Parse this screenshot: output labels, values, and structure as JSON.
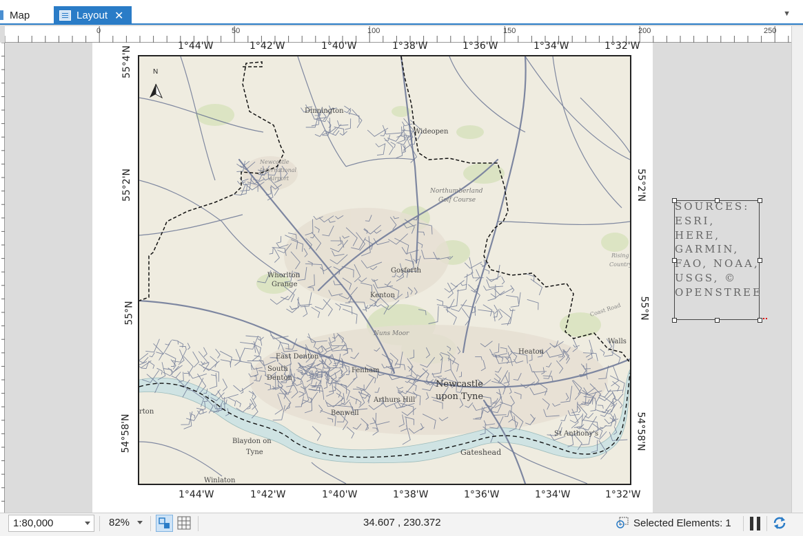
{
  "tabs": [
    {
      "label": "Map",
      "active": false
    },
    {
      "label": "Layout",
      "active": true,
      "close": "✕"
    }
  ],
  "ruler": {
    "horizontal_labels": [
      "0",
      "50",
      "100",
      "150",
      "200",
      "250"
    ]
  },
  "map": {
    "north_arrow": "N",
    "grid_top": [
      "1°44'W",
      "1°42'W",
      "1°40'W",
      "1°38'W",
      "1°36'W",
      "1°34'W",
      "1°32'W"
    ],
    "grid_bottom": [
      "1°44'W",
      "1°42'W",
      "1°40'W",
      "1°38'W",
      "1°36'W",
      "1°34'W",
      "1°32'W"
    ],
    "grid_left": [
      "55°4'N",
      "55°2'N",
      "55°N",
      "54°58'N"
    ],
    "grid_right": [
      "55°2'N",
      "55°N",
      "54°58'N"
    ],
    "place_labels": {
      "dinnington": "Dinnington",
      "wideopen": "Wideopen",
      "airport_1": "Newcastle",
      "airport_2": "International",
      "airport_3": "Airport",
      "golf_1": "Northumberland",
      "golf_2": "Golf Course",
      "whorlton_1": "Whorlton",
      "whorlton_2": "Grange",
      "gosforth": "Gosforth",
      "kenton": "Kenton",
      "nuns_moor": "Nuns Moor",
      "east_denton": "East Denton",
      "south_1": "South",
      "south_2": "Denton",
      "fenham": "Fenham",
      "heaton": "Heaton",
      "newcastle_1": "Newcastle",
      "newcastle_2": "upon Tyne",
      "arthurs_hill": "Arthurs Hill",
      "benwell": "Benwell",
      "st_anthonys": "St Anthony's",
      "blaydon_1": "Blaydon on",
      "blaydon_2": "Tyne",
      "gateshead": "Gateshead",
      "winlaton": "Winlaton",
      "rising_1": "Rising",
      "rising_2": "Country",
      "walls": "Walls",
      "coast_road": "Coast Road",
      "rton": "rton"
    }
  },
  "sources_text": "SOURCES: ESRI, HERE, GARMIN, FAO, NOAA, USGS, © OPENSTREE",
  "statusbar": {
    "scale": "1:80,000",
    "zoom": "82%",
    "coordinates": "34.607 , 230.372",
    "selected_elements": "Selected Elements: 1"
  },
  "icons": {
    "map_tab": "map-icon",
    "layout_tab": "layout-icon",
    "snap": "snap-to-icon",
    "grid": "grid-icon",
    "selection": "selected-elements-icon",
    "pause": "pause-drawing-icon",
    "refresh": "refresh-icon"
  },
  "colors": {
    "accent": "#2a7cc7",
    "map_background": "#efece0",
    "roads": "#6b7694",
    "water": "#cfe3e3",
    "green": "#d9e3c0"
  }
}
